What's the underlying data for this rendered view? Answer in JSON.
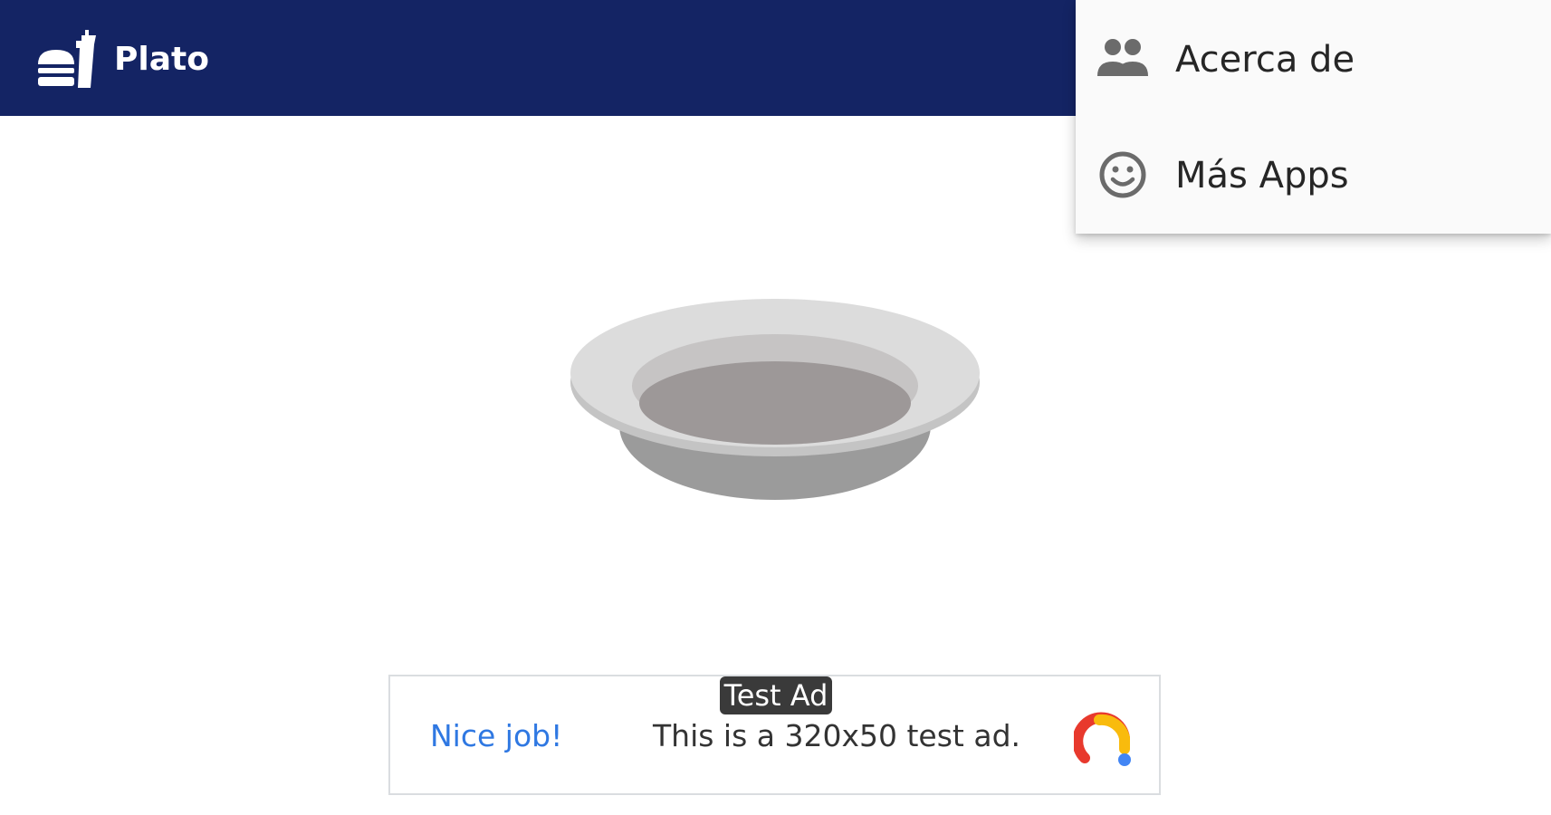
{
  "app": {
    "title": "Plato",
    "logo_icon": "fastfood-icon"
  },
  "overflow_menu": {
    "items": [
      {
        "label": "Acerca de",
        "icon": "people-icon"
      },
      {
        "label": "Más Apps",
        "icon": "smiley-face-icon"
      }
    ]
  },
  "main": {
    "image_icon": "empty-plate-illustration"
  },
  "ad": {
    "badge": "Test Ad",
    "headline": "Nice job!",
    "body": "This is a 320x50 test ad.",
    "logo_icon": "admob-logo",
    "colors": {
      "headline": "#2f78e2",
      "logo_red": "#e8392d",
      "logo_yellow": "#f9bb0d",
      "logo_blue": "#4285f4"
    }
  },
  "colors": {
    "toolbar": "#142464",
    "menu_background": "#fafafa",
    "plate_rim": "#d9d9d9",
    "plate_base": "#9b9b9b"
  }
}
